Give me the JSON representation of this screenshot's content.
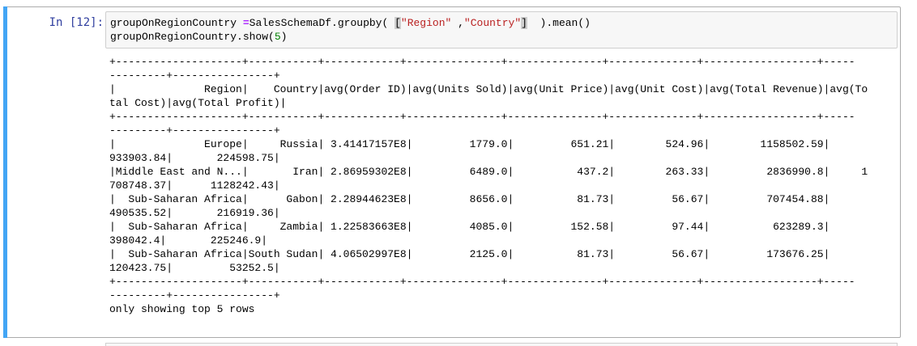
{
  "cell": {
    "prompt": "In [12]:",
    "code": {
      "line1_var": "groupOnRegionCountry ",
      "line1_op": "=",
      "line1_mid": "SalesSchemaDf.groupby( ",
      "line1_bracket_open": "[",
      "line1_str1": "\"Region\"",
      "line1_sep": " ,",
      "line1_str2": "\"Country\"",
      "line1_bracket_close": "]",
      "line1_end": "  ).mean()",
      "line2_start": "groupOnRegionCountry.show(",
      "line2_num": "5",
      "line2_end": ")"
    },
    "output": {
      "border": "+--------------------+-----------+------------+---------------+---------------+--------------+------------------+-----\n---------+----------------+",
      "header": "|              Region|    Country|avg(Order ID)|avg(Units Sold)|avg(Unit Price)|avg(Unit Cost)|avg(Total Revenue)|avg(To\ntal Cost)|avg(Total Profit)|",
      "rows": [
        "|              Europe|     Russia| 3.41417157E8|         1779.0|         651.21|        524.96|        1158502.59|     \n933903.84|       224598.75|",
        "|Middle East and N...|       Iran| 2.86959302E8|         6489.0|          437.2|        263.33|         2836990.8|     1\n708748.37|      1128242.43|",
        "|  Sub-Saharan Africa|      Gabon| 2.28944623E8|         8656.0|          81.73|         56.67|         707454.88|     \n490535.52|       216919.36|",
        "|  Sub-Saharan Africa|     Zambia| 1.22583663E8|         4085.0|         152.58|         97.44|          623289.3|     \n398042.4|       225246.9|",
        "|  Sub-Saharan Africa|South Sudan| 4.06502997E8|         2125.0|          81.73|         56.67|         173676.25|     \n120423.75|         53252.5|"
      ],
      "footer": "only showing top 5 rows"
    }
  },
  "colors": {
    "prompt": "#303f9f",
    "selected_bar": "#42a5f5",
    "string": "#ba2121",
    "number": "#008000",
    "operator": "#aa22ff"
  }
}
